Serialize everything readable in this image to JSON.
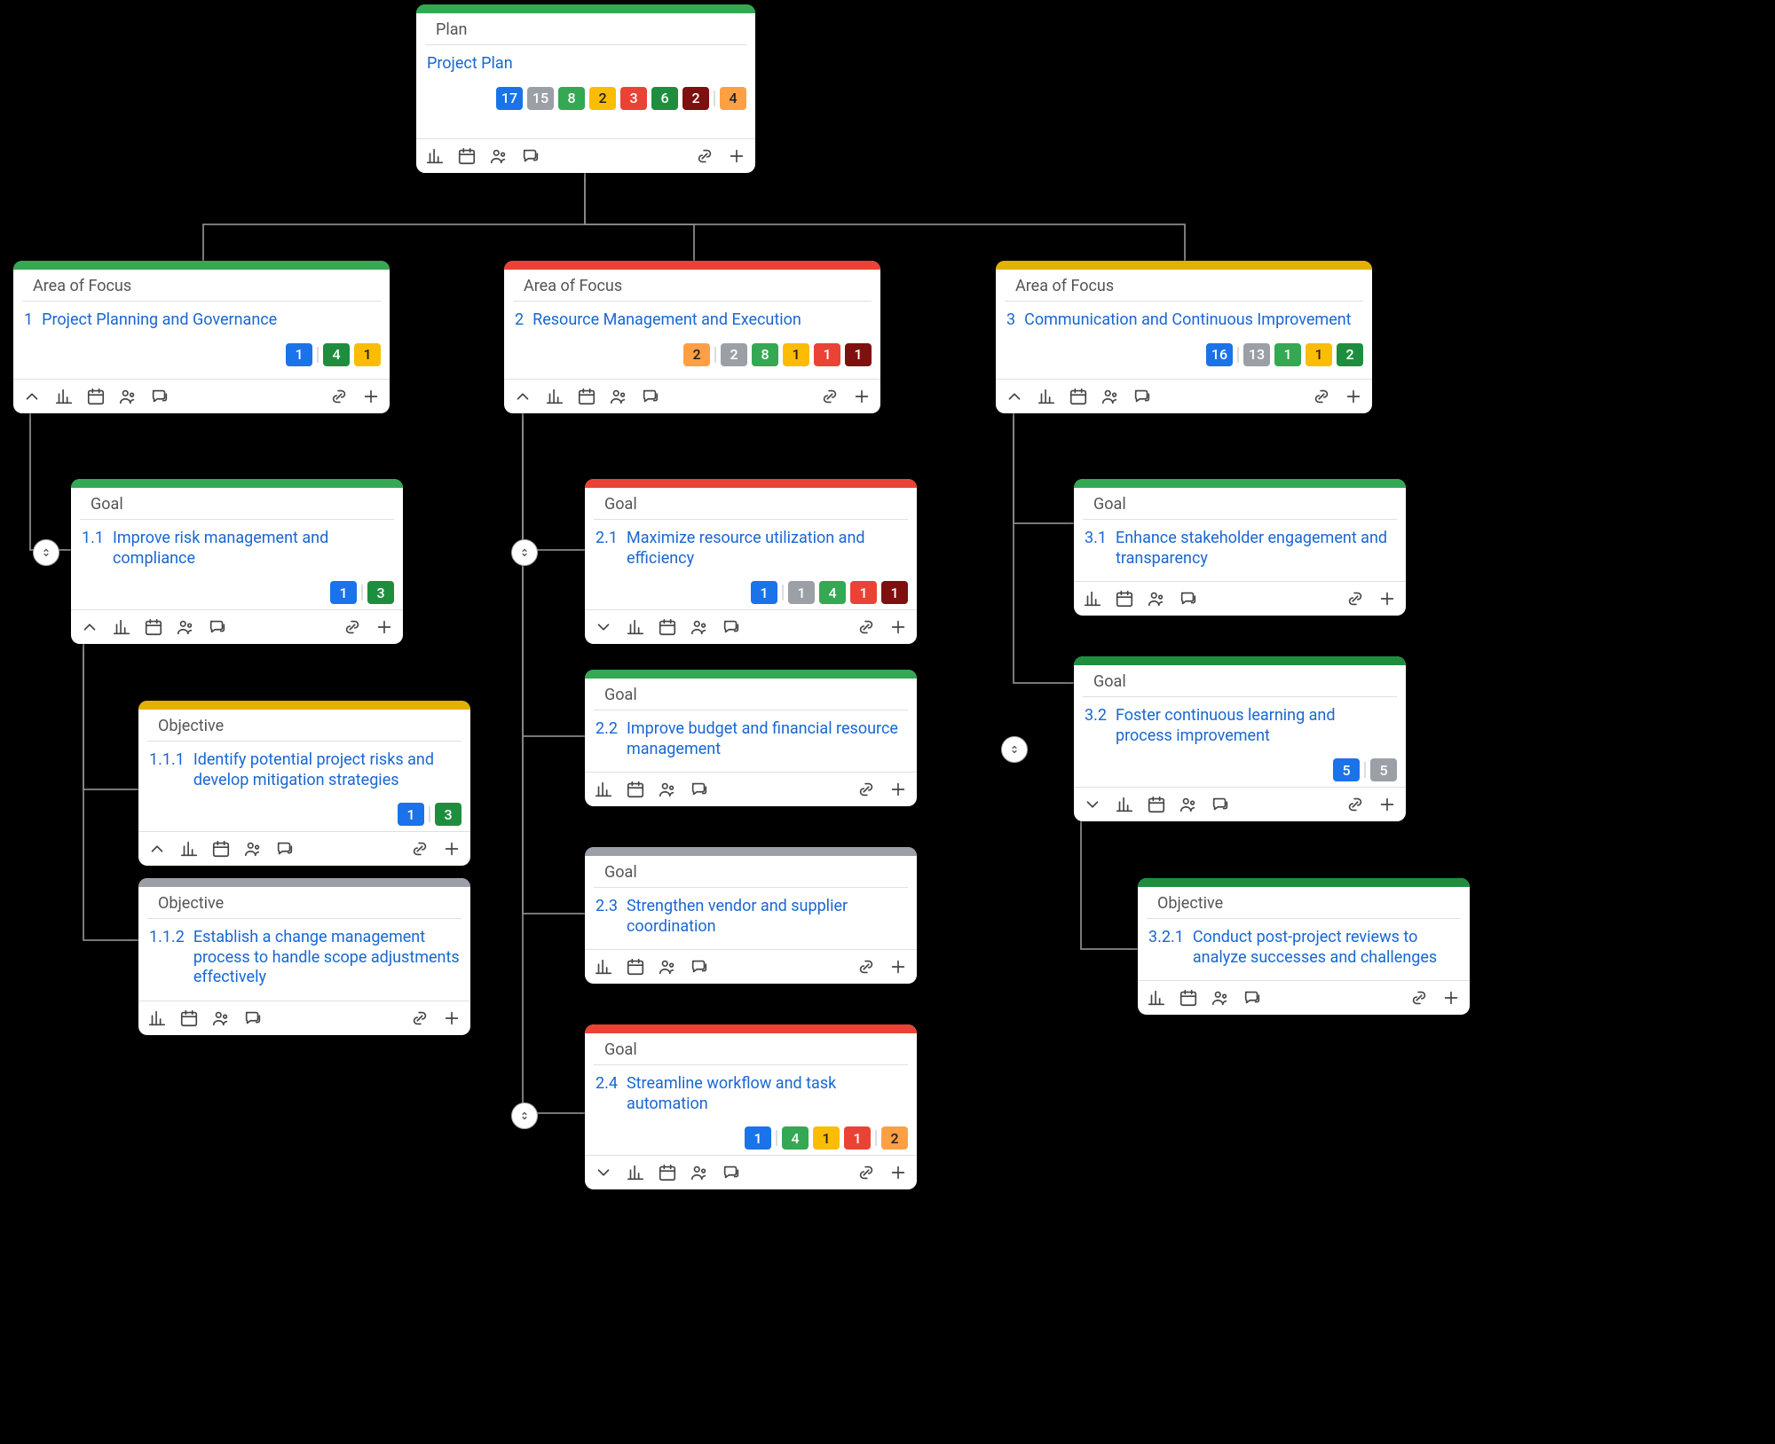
{
  "labels": {
    "plan": "Plan",
    "area": "Area of Focus",
    "goal": "Goal",
    "obj": "Objective"
  },
  "root": {
    "title": "Project Plan",
    "badges": [
      [
        "blue",
        "17"
      ],
      [
        "gray",
        "15"
      ],
      [
        "green",
        "8"
      ],
      [
        "yellow",
        "2"
      ],
      [
        "red",
        "3"
      ],
      [
        "dgreen",
        "6"
      ],
      [
        "maroon",
        "2"
      ],
      [
        "sep",
        ""
      ],
      [
        "orange",
        "4"
      ]
    ]
  },
  "areas": [
    {
      "n": "1",
      "t": "Project Planning and Governance",
      "bar": "green",
      "badges": [
        [
          "blue",
          "1"
        ],
        [
          "sep",
          ""
        ],
        [
          "dgreen",
          "4"
        ],
        [
          "yellow",
          "1"
        ]
      ],
      "goals": [
        {
          "n": "1.1",
          "t": "Improve risk management and compliance",
          "bar": "green",
          "badges": [
            [
              "blue",
              "1"
            ],
            [
              "sep",
              ""
            ],
            [
              "dgreen",
              "3"
            ]
          ],
          "objs": [
            {
              "n": "1.1.1",
              "t": "Identify potential project risks and develop mitigation strategies",
              "bar": "yellow",
              "badges": [
                [
                  "blue",
                  "1"
                ],
                [
                  "sep",
                  ""
                ],
                [
                  "dgreen",
                  "3"
                ]
              ]
            },
            {
              "n": "1.1.2",
              "t": "Establish a change management process to handle scope adjustments effectively",
              "bar": "gray"
            }
          ]
        }
      ]
    },
    {
      "n": "2",
      "t": "Resource Management and Execution",
      "bar": "red",
      "badges": [
        [
          "orange",
          "2"
        ],
        [
          "sep",
          ""
        ],
        [
          "gray",
          "2"
        ],
        [
          "green",
          "8"
        ],
        [
          "yellow",
          "1"
        ],
        [
          "red",
          "1"
        ],
        [
          "maroon",
          "1"
        ]
      ],
      "goals": [
        {
          "n": "2.1",
          "t": "Maximize resource utilization and efficiency",
          "bar": "red",
          "badges": [
            [
              "blue",
              "1"
            ],
            [
              "sep",
              ""
            ],
            [
              "gray",
              "1"
            ],
            [
              "green",
              "4"
            ],
            [
              "red",
              "1"
            ],
            [
              "maroon",
              "1"
            ]
          ]
        },
        {
          "n": "2.2",
          "t": "Improve budget and financial resource management",
          "bar": "green"
        },
        {
          "n": "2.3",
          "t": "Strengthen vendor and supplier coordination",
          "bar": "gray"
        },
        {
          "n": "2.4",
          "t": "Streamline workflow and task automation",
          "bar": "red",
          "badges": [
            [
              "blue",
              "1"
            ],
            [
              "sep",
              ""
            ],
            [
              "green",
              "4"
            ],
            [
              "yellow",
              "1"
            ],
            [
              "red",
              "1"
            ],
            [
              "sep",
              ""
            ],
            [
              "orange",
              "2"
            ]
          ]
        }
      ]
    },
    {
      "n": "3",
      "t": "Communication and Continuous Improvement",
      "bar": "yellow",
      "badges": [
        [
          "blue",
          "16"
        ],
        [
          "sep",
          ""
        ],
        [
          "gray",
          "13"
        ],
        [
          "green",
          "1"
        ],
        [
          "yellow",
          "1"
        ],
        [
          "dgreen",
          "2"
        ]
      ],
      "goals": [
        {
          "n": "3.1",
          "t": "Enhance stakeholder engagement and transparency",
          "bar": "green"
        },
        {
          "n": "3.2",
          "t": "Foster continuous learning and process improvement",
          "bar": "dgreen",
          "badges": [
            [
              "blue",
              "5"
            ],
            [
              "sep",
              ""
            ],
            [
              "gray",
              "5"
            ]
          ],
          "objs": [
            {
              "n": "3.2.1",
              "t": "Conduct post-project reviews to analyze successes and challenges",
              "bar": "dgreen"
            }
          ]
        }
      ]
    }
  ]
}
